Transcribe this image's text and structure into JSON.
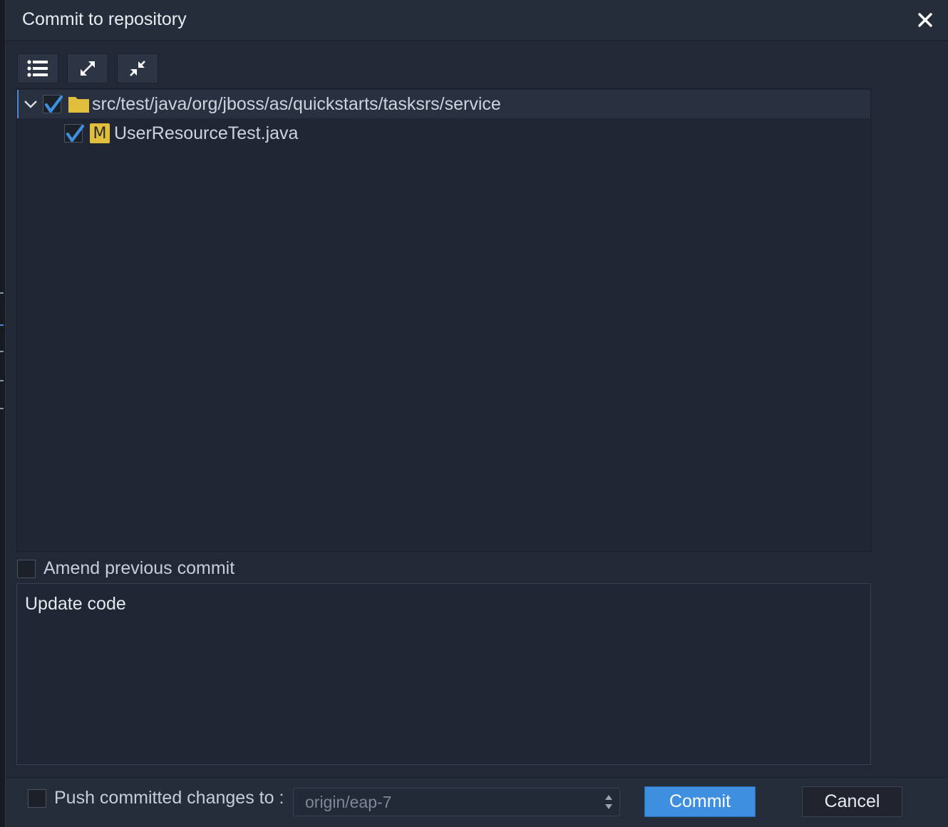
{
  "dialog": {
    "title": "Commit to repository",
    "close_icon": "close-icon"
  },
  "toolbar": {
    "buttons": [
      {
        "icon": "list-view-icon"
      },
      {
        "icon": "expand-all-icon"
      },
      {
        "icon": "collapse-all-icon"
      }
    ]
  },
  "tree": {
    "folder": {
      "path": "src/test/java/org/jboss/as/quickstarts/tasksrs/service",
      "checked": true,
      "expanded": true,
      "icon": "folder-icon"
    },
    "files": [
      {
        "name": "UserResourceTest.java",
        "status": "M",
        "checked": true
      }
    ]
  },
  "amend": {
    "label": "Amend previous commit",
    "checked": false
  },
  "message": {
    "text": "Update code"
  },
  "footer": {
    "push_label": "Push committed changes to :",
    "push_checked": false,
    "remote_value": "origin/eap-7",
    "commit_label": "Commit",
    "cancel_label": "Cancel"
  },
  "colors": {
    "accent": "#3f8fe0",
    "modified_badge": "#e1bf3c",
    "folder": "#e1bf3c",
    "background": "#222835"
  }
}
